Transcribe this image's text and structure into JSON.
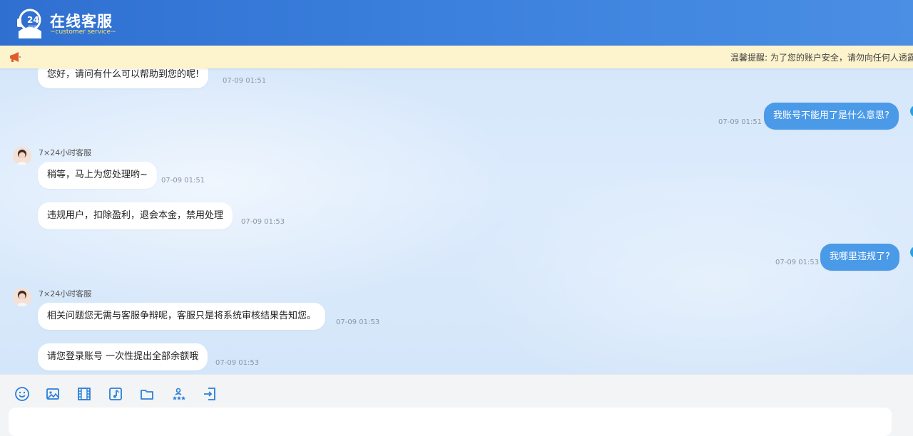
{
  "header": {
    "logo_number": "24",
    "logo_hours": "HOURS",
    "title": "在线客服",
    "subtitle": "customer service"
  },
  "notice": {
    "icon": "megaphone-icon",
    "text": "温馨提醒: 为了您的账户安全，请勿向任何人透露"
  },
  "colors": {
    "header_blue": "#3a7fdc",
    "user_bubble": "#4a9ae8",
    "notice_bg": "#fdf3cc"
  },
  "messages": [
    {
      "from": "agent",
      "text": "您好，请问有什么可以帮助到您的呢!",
      "time": "07-09 01:51"
    },
    {
      "from": "user",
      "text": "我账号不能用了是什么意思?",
      "time": "07-09 01:51"
    },
    {
      "from": "agent",
      "name": "7×24小时客服",
      "text": "稍等，马上为您处理哟~",
      "time": "07-09 01:51"
    },
    {
      "from": "agent",
      "text": "违规用户，扣除盈利，退会本金，禁用处理",
      "time": "07-09 01:53"
    },
    {
      "from": "user",
      "text": "我哪里违规了?",
      "time": "07-09 01:53"
    },
    {
      "from": "agent",
      "name": "7×24小时客服",
      "text": "相关问题您无需与客服争辩呢，客服只是将系统审核结果告知您。",
      "time": "07-09 01:53"
    },
    {
      "from": "agent",
      "text": "请您登录账号 一次性提出全部余额哦",
      "time": "07-09 01:53"
    }
  ],
  "toolbar": {
    "icons": [
      "emoji-icon",
      "image-icon",
      "video-icon",
      "music-icon",
      "folder-icon",
      "rating-icon",
      "transfer-icon"
    ]
  }
}
